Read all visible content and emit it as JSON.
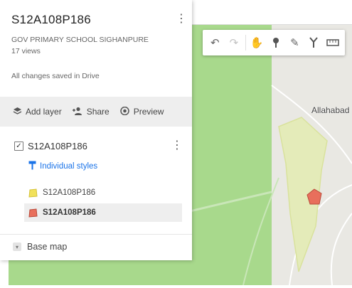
{
  "map": {
    "place_label": "Allahabad",
    "colors": {
      "park": "#a8d98c",
      "land": "#e9e8e3",
      "area_fill": "#e4ebb9",
      "marker": "#e86f5c"
    }
  },
  "toolbar": {
    "tools": [
      {
        "name": "undo-icon",
        "glyph": "↶",
        "enabled": true
      },
      {
        "name": "redo-icon",
        "glyph": "↷",
        "enabled": false
      },
      {
        "name": "hand-pan-icon",
        "glyph": "✋",
        "enabled": true
      },
      {
        "name": "add-marker-icon",
        "glyph": "⚲",
        "enabled": true
      },
      {
        "name": "draw-line-icon",
        "glyph": "✎",
        "enabled": true
      },
      {
        "name": "directions-icon",
        "glyph": "Y",
        "enabled": true
      },
      {
        "name": "measure-ruler-icon",
        "glyph": "▭",
        "enabled": true
      }
    ]
  },
  "panel": {
    "title": "S12A108P186",
    "description": "GOV PRIMARY SCHOOL SIGHANPURE",
    "views": "17 views",
    "save_status": "All changes saved in Drive",
    "actions": {
      "add_layer": "Add layer",
      "share": "Share",
      "preview": "Preview"
    },
    "layer": {
      "name": "S12A108P186",
      "checked": true,
      "styles_label": "Individual styles",
      "features": [
        {
          "label": "S12A108P186",
          "color": "#f1e15b",
          "selected": false
        },
        {
          "label": "S12A108P186",
          "color": "#e86f5c",
          "selected": true
        }
      ]
    },
    "base_map_label": "Base map"
  }
}
